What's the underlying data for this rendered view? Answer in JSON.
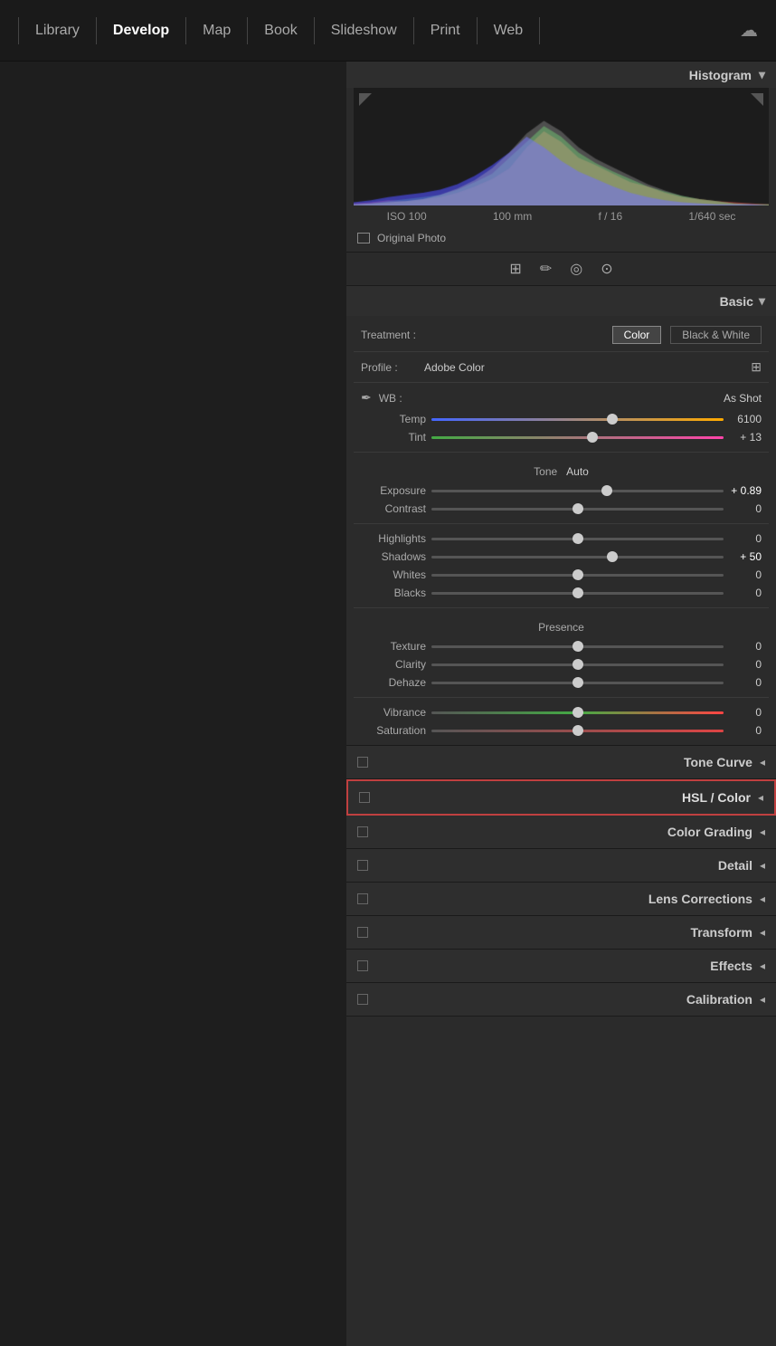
{
  "nav": {
    "items": [
      "Library",
      "Develop",
      "Map",
      "Book",
      "Slideshow",
      "Print",
      "Web"
    ],
    "active": "Develop"
  },
  "histogram": {
    "title": "Histogram",
    "exif": {
      "iso": "ISO 100",
      "focal": "100 mm",
      "aperture": "f / 16",
      "shutter": "1/640 sec"
    },
    "original_photo": "Original Photo"
  },
  "basic": {
    "title": "Basic",
    "treatment": {
      "label": "Treatment :",
      "options": [
        "Color",
        "Black & White"
      ],
      "active": "Color"
    },
    "profile": {
      "label": "Profile :",
      "value": "Adobe Color"
    },
    "wb": {
      "label": "WB :",
      "value": "As Shot"
    },
    "sliders": [
      {
        "name": "Temp",
        "position": 62,
        "value": "6100",
        "type": "temp"
      },
      {
        "name": "Tint",
        "position": 55,
        "value": "+ 13",
        "type": "tint"
      }
    ],
    "tone_label": "Tone",
    "auto_label": "Auto",
    "tone_sliders": [
      {
        "name": "Exposure",
        "position": 60,
        "value": "+ 0.89",
        "bold": true
      },
      {
        "name": "Contrast",
        "position": 50,
        "value": "0"
      }
    ],
    "adjust_sliders": [
      {
        "name": "Highlights",
        "position": 50,
        "value": "0"
      },
      {
        "name": "Shadows",
        "position": 62,
        "value": "+ 50",
        "bold": true
      },
      {
        "name": "Whites",
        "position": 50,
        "value": "0"
      },
      {
        "name": "Blacks",
        "position": 50,
        "value": "0"
      }
    ],
    "presence_label": "Presence",
    "presence_sliders": [
      {
        "name": "Texture",
        "position": 50,
        "value": "0"
      },
      {
        "name": "Clarity",
        "position": 50,
        "value": "0"
      },
      {
        "name": "Dehaze",
        "position": 50,
        "value": "0"
      }
    ],
    "color_sliders": [
      {
        "name": "Vibrance",
        "position": 50,
        "value": "0",
        "type": "vibrance"
      },
      {
        "name": "Saturation",
        "position": 50,
        "value": "0",
        "type": "saturation"
      }
    ]
  },
  "panels": [
    {
      "id": "tone-curve",
      "title": "Tone Curve",
      "active": false
    },
    {
      "id": "hsl-color",
      "title": "HSL / Color",
      "active": true,
      "highlight": true
    },
    {
      "id": "color-grading",
      "title": "Color Grading",
      "active": false
    },
    {
      "id": "detail",
      "title": "Detail",
      "active": false
    },
    {
      "id": "lens-corrections",
      "title": "Lens Corrections",
      "active": false
    },
    {
      "id": "transform",
      "title": "Transform",
      "active": false
    },
    {
      "id": "effects",
      "title": "Effects",
      "active": false
    },
    {
      "id": "calibration",
      "title": "Calibration",
      "active": false
    }
  ]
}
